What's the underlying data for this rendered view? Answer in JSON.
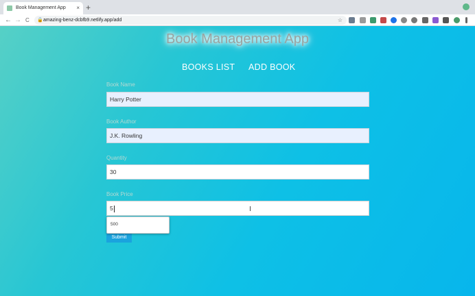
{
  "browser": {
    "tab_title": "Book Management App",
    "tab_close": "×",
    "new_tab": "+",
    "back": "←",
    "forward": "→",
    "reload": "C",
    "lock": "🔒",
    "url": "amazing-benz-dcbfb9.netlify.app/add",
    "bookmark": "☆"
  },
  "app": {
    "title": "Book Management App",
    "nav": {
      "books_list": "BOOKS LIST",
      "add_book": "ADD BOOK"
    }
  },
  "form": {
    "book_name": {
      "label": "Book Name",
      "value": "Harry Potter"
    },
    "book_author": {
      "label": "Book Author",
      "value": "J.K. Rowling"
    },
    "quantity": {
      "label": "Quantity",
      "value": "30"
    },
    "book_price": {
      "label": "Book Price",
      "value": "5"
    },
    "autocomplete_option": "500",
    "submit_label": "Submit"
  },
  "cursor_glyph": "I",
  "colors": {
    "gradient_start": "#56d0c6",
    "gradient_end": "#07b6ec",
    "autofill_bg": "#e8f0fe",
    "submit_bg": "#1aa3de"
  }
}
